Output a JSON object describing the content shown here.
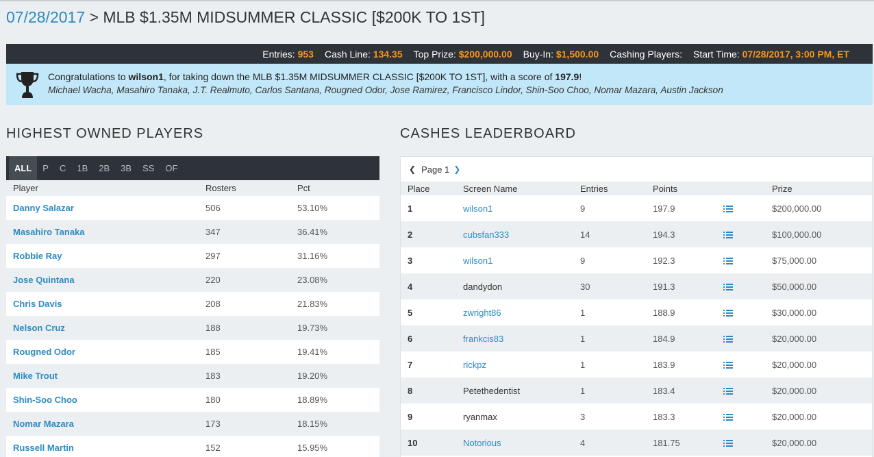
{
  "header": {
    "date": "07/28/2017",
    "separator": " > ",
    "contest_name": "MLB $1.35M MIDSUMMER CLASSIC [$200K TO 1ST]"
  },
  "stats": {
    "entries_label": "Entries:",
    "entries_value": "953",
    "cash_line_label": "Cash Line:",
    "cash_line_value": "134.35",
    "top_prize_label": "Top Prize:",
    "top_prize_value": "$200,000.00",
    "buy_in_label": "Buy-In:",
    "buy_in_value": "$1,500.00",
    "cashing_players_label": "Cashing Players:",
    "cashing_players_value": "",
    "start_time_label": "Start Time:",
    "start_time_value": "07/28/2017, 3:00 PM, ET"
  },
  "congrats": {
    "prefix": "Congratulations to ",
    "winner": "wilson1",
    "middle": ", for taking down the MLB $1.35M MIDSUMMER CLASSIC [$200K TO 1ST], with a score of ",
    "score": "197.9",
    "suffix": "!",
    "lineup": "Michael Wacha, Masahiro Tanaka, J.T. Realmuto, Carlos Santana, Rougned Odor, Jose Ramirez, Francisco Lindor, Shin-Soo Choo, Nomar Mazara, Austin Jackson"
  },
  "owned": {
    "section_title": "HIGHEST OWNED PLAYERS",
    "tabs": [
      "ALL",
      "P",
      "C",
      "1B",
      "2B",
      "3B",
      "SS",
      "OF"
    ],
    "active_tab": "ALL",
    "columns": {
      "player": "Player",
      "rosters": "Rosters",
      "pct": "Pct"
    },
    "rows": [
      {
        "player": "Danny Salazar",
        "rosters": "506",
        "pct": "53.10%"
      },
      {
        "player": "Masahiro Tanaka",
        "rosters": "347",
        "pct": "36.41%"
      },
      {
        "player": "Robbie Ray",
        "rosters": "297",
        "pct": "31.16%"
      },
      {
        "player": "Jose Quintana",
        "rosters": "220",
        "pct": "23.08%"
      },
      {
        "player": "Chris Davis",
        "rosters": "208",
        "pct": "21.83%"
      },
      {
        "player": "Nelson Cruz",
        "rosters": "188",
        "pct": "19.73%"
      },
      {
        "player": "Rougned Odor",
        "rosters": "185",
        "pct": "19.41%"
      },
      {
        "player": "Mike Trout",
        "rosters": "183",
        "pct": "19.20%"
      },
      {
        "player": "Shin-Soo Choo",
        "rosters": "180",
        "pct": "18.89%"
      },
      {
        "player": "Nomar Mazara",
        "rosters": "173",
        "pct": "18.15%"
      },
      {
        "player": "Russell Martin",
        "rosters": "152",
        "pct": "15.95%"
      }
    ]
  },
  "cashes": {
    "section_title": "CASHES LEADERBOARD",
    "page_label": "Page 1",
    "prev_icon": "chevron-left-icon",
    "next_icon": "chevron-right-icon",
    "columns": {
      "place": "Place",
      "screen_name": "Screen Name",
      "entries": "Entries",
      "points": "Points",
      "prize": "Prize"
    },
    "rows": [
      {
        "place": "1",
        "name": "wilson1",
        "linked": true,
        "entries": "9",
        "points": "197.9",
        "prize": "$200,000.00"
      },
      {
        "place": "2",
        "name": "cubsfan333",
        "linked": true,
        "entries": "14",
        "points": "194.3",
        "prize": "$100,000.00"
      },
      {
        "place": "3",
        "name": "wilson1",
        "linked": true,
        "entries": "9",
        "points": "192.3",
        "prize": "$75,000.00"
      },
      {
        "place": "4",
        "name": "dandydon",
        "linked": false,
        "entries": "30",
        "points": "191.3",
        "prize": "$50,000.00"
      },
      {
        "place": "5",
        "name": "zwright86",
        "linked": true,
        "entries": "1",
        "points": "188.9",
        "prize": "$30,000.00"
      },
      {
        "place": "6",
        "name": "frankcis83",
        "linked": true,
        "entries": "1",
        "points": "184.9",
        "prize": "$20,000.00"
      },
      {
        "place": "7",
        "name": "rickpz",
        "linked": true,
        "entries": "1",
        "points": "183.9",
        "prize": "$20,000.00"
      },
      {
        "place": "8",
        "name": "Petethedentist",
        "linked": false,
        "entries": "1",
        "points": "183.4",
        "prize": "$20,000.00"
      },
      {
        "place": "9",
        "name": "ryanmax",
        "linked": false,
        "entries": "3",
        "points": "183.3",
        "prize": "$20,000.00"
      },
      {
        "place": "10",
        "name": "Notorious",
        "linked": true,
        "entries": "4",
        "points": "181.75",
        "prize": "$20,000.00"
      }
    ]
  },
  "colors": {
    "link": "#2b8cc4",
    "accent": "#f7941d",
    "dark_bar": "#2d3338",
    "banner": "#c2e7f8"
  }
}
